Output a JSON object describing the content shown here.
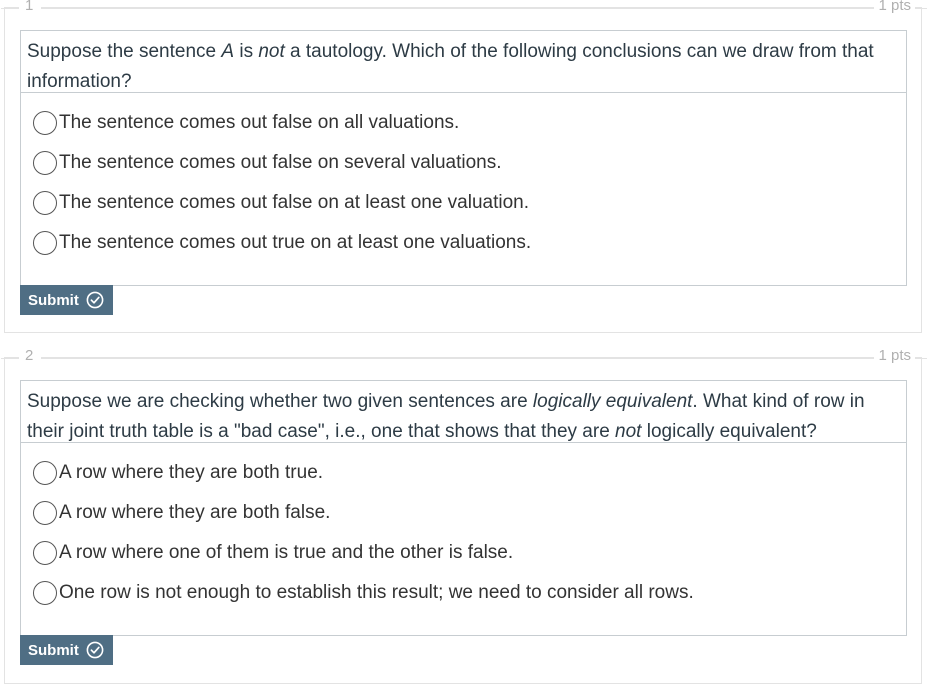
{
  "questions": [
    {
      "number": "1",
      "points": "1 pts",
      "text_parts": [
        "Suppose the sentence ",
        "A",
        " is ",
        "not",
        " a tautology. Which of the following conclusions can we draw from that information?"
      ],
      "answers": [
        "The sentence comes out false on all valuations.",
        "The sentence comes out false on several valuations.",
        "The sentence comes out false on at least one valuation.",
        "The sentence comes out true on at least one valuations."
      ],
      "submit_label": "Submit"
    },
    {
      "number": "2",
      "points": "1 pts",
      "text_parts": [
        "Suppose we are checking whether two given sentences are ",
        "logically equivalent",
        ". What kind of row in their joint truth table is a \"bad case\", i.e., one that shows that they are ",
        "not",
        " logically equivalent?"
      ],
      "answers": [
        "A row where they are both true.",
        "A row where they are both false.",
        "A row where one of them is true and the other is false.",
        "One row is not enough to establish this result; we need to consider all rows."
      ],
      "submit_label": "Submit"
    }
  ],
  "icons": {
    "radio": "radio-circle-icon",
    "submit": "check-circle-icon"
  },
  "colors": {
    "submit_bg": "#4f6e84",
    "border": "#c7cdd1",
    "muted_text": "#b0b0b0"
  }
}
